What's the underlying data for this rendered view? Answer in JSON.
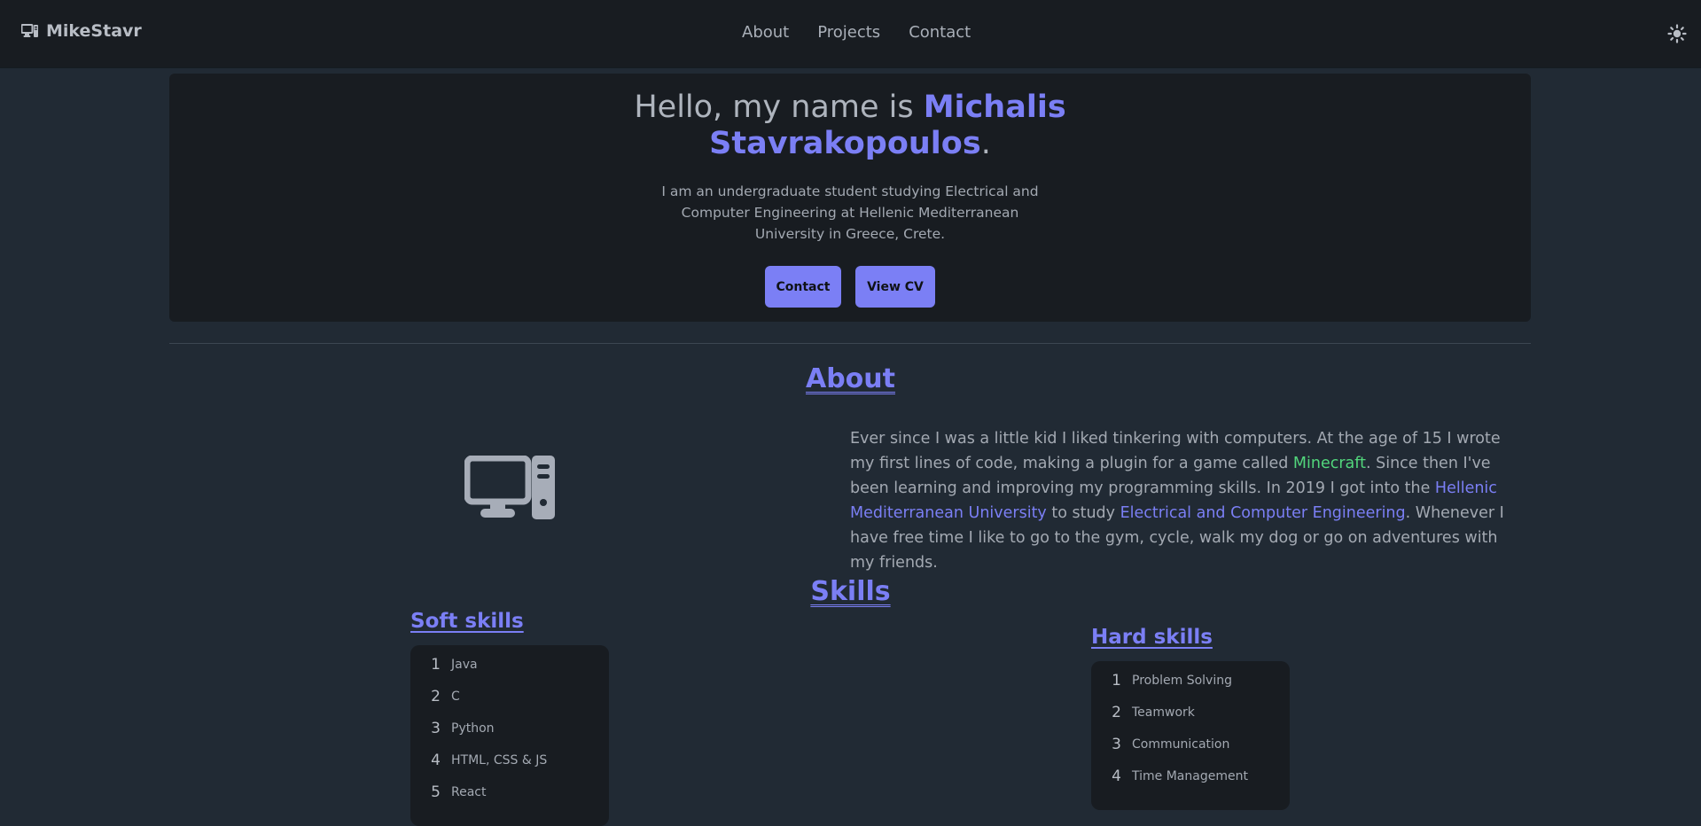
{
  "navbar": {
    "brand": "MikeStavr",
    "brand_icon": "desktop-computer-icon",
    "links": [
      "About",
      "Projects",
      "Contact"
    ],
    "theme_icon": "sun-icon"
  },
  "hero": {
    "greeting": "Hello, my name is ",
    "name_line1": "Michalis",
    "name_line2": "Stavrakopoulos",
    "period": ".",
    "description": "I am an undergraduate student studying Electrical and Computer Engineering at Hellenic Mediterranean University in Greece, Crete.",
    "contact_button": "Contact",
    "cv_button": "View CV"
  },
  "about": {
    "heading": "About",
    "icon": "desktop-computer-icon",
    "p1": "Ever since I was a little kid I liked tinkering with computers. At the age of 15 I wrote my first lines of code, making a plugin for a game called ",
    "minecraft": "Minecraft",
    "p2": ". Since then I've been learning and improving my programming skills. In 2019 I got into the ",
    "university": "Hellenic Mediterranean University",
    "p3": " to study ",
    "department": "Electrical and Computer Engineering",
    "p4": ". Whenever I have free time I like to go to the gym, cycle, walk my dog or go on adventures with my friends."
  },
  "skills": {
    "heading": "Skills",
    "soft": {
      "heading": "Soft skills",
      "items": [
        {
          "num": "1",
          "label": "Java"
        },
        {
          "num": "2",
          "label": "C"
        },
        {
          "num": "3",
          "label": "Python"
        },
        {
          "num": "4",
          "label": "HTML, CSS & JS"
        },
        {
          "num": "5",
          "label": "React"
        }
      ]
    },
    "hard": {
      "heading": "Hard skills",
      "items": [
        {
          "num": "1",
          "label": "Problem Solving"
        },
        {
          "num": "2",
          "label": "Teamwork"
        },
        {
          "num": "3",
          "label": "Communication"
        },
        {
          "num": "4",
          "label": "Time Management"
        }
      ]
    }
  },
  "colors": {
    "accent": "#7b7ff5",
    "green": "#52d67c",
    "background": "#212a34",
    "surface": "#181c21"
  }
}
